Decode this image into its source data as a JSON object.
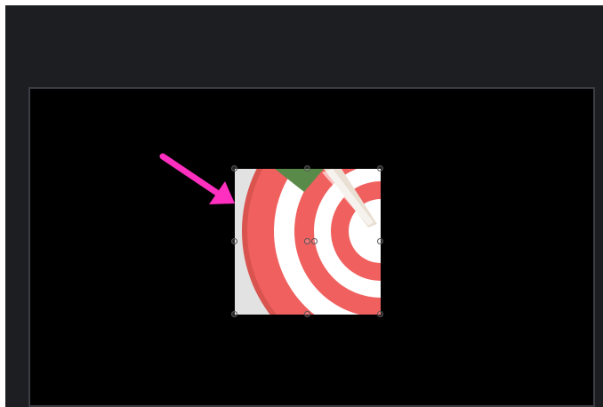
{
  "canvas": {
    "background_color": "#000000",
    "frame_color": "#1c1e22"
  },
  "layer": {
    "kind": "image",
    "icon": "target-dartboard-icon",
    "selected": true,
    "handles": [
      "top-left",
      "top-center",
      "top-right",
      "middle-left",
      "center",
      "center-rotate",
      "middle-right",
      "bottom-left",
      "bottom-center",
      "bottom-right"
    ],
    "colors": {
      "ring_red": "#f0605e",
      "ring_white": "#ffffff",
      "background_gray": "#e2e2e2",
      "flag_green": "#5a8a4a",
      "dart_beige": "#e9dfd2"
    }
  },
  "annotation": {
    "icon": "pointer-arrow-icon",
    "color": "#ff2fbf"
  }
}
